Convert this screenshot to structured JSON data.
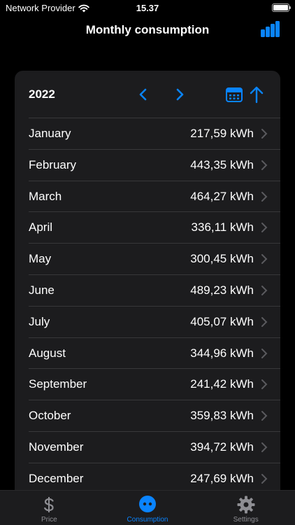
{
  "status": {
    "carrier": "Network Provider",
    "time": "15.37"
  },
  "nav": {
    "title": "Monthly consumption"
  },
  "card": {
    "year": "2022",
    "months": [
      {
        "month": "January",
        "value": "217,59 kWh"
      },
      {
        "month": "February",
        "value": "443,35 kWh"
      },
      {
        "month": "March",
        "value": "464,27 kWh"
      },
      {
        "month": "April",
        "value": "336,11 kWh"
      },
      {
        "month": "May",
        "value": "300,45 kWh"
      },
      {
        "month": "June",
        "value": "489,23 kWh"
      },
      {
        "month": "July",
        "value": "405,07 kWh"
      },
      {
        "month": "August",
        "value": "344,96 kWh"
      },
      {
        "month": "September",
        "value": "241,42 kWh"
      },
      {
        "month": "October",
        "value": "359,83 kWh"
      },
      {
        "month": "November",
        "value": "394,72 kWh"
      },
      {
        "month": "December",
        "value": "247,69 kWh"
      }
    ]
  },
  "tabs": [
    {
      "label": "Price",
      "icon": "dollar-icon"
    },
    {
      "label": "Consumption",
      "icon": "plug-icon"
    },
    {
      "label": "Settings",
      "icon": "gear-icon"
    }
  ],
  "colors": {
    "accent": "#0a84ff",
    "inactive": "#8e8e93",
    "card": "#1c1c1e"
  }
}
